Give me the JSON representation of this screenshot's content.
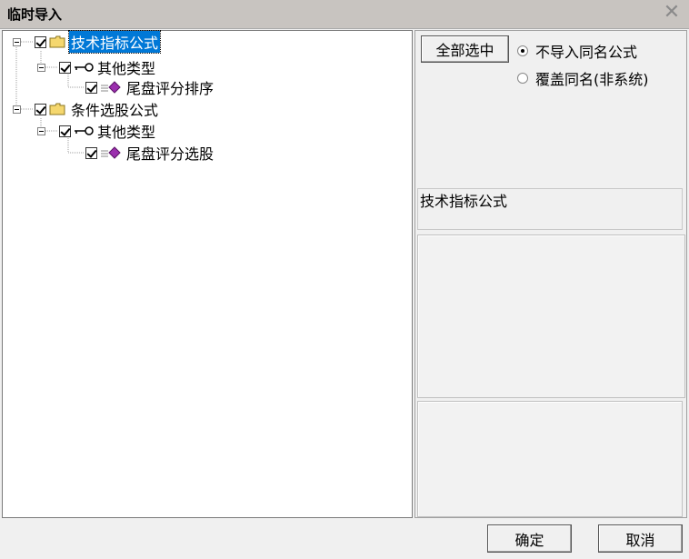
{
  "window": {
    "title": "临时导入"
  },
  "tree": [
    {
      "label": "技术指标公式",
      "icon": "folder-icon",
      "selected": true
    },
    {
      "label": "其他类型",
      "icon": "key-icon"
    },
    {
      "label": "尾盘评分排序",
      "icon": "formula-gem-icon"
    },
    {
      "label": "条件选股公式",
      "icon": "folder-icon"
    },
    {
      "label": "其他类型",
      "icon": "key-icon"
    },
    {
      "label": "尾盘评分选股",
      "icon": "formula-gem-icon"
    }
  ],
  "options": {
    "select_all_label": "全部选中",
    "skip_same_name_label": "不导入同名公式",
    "overwrite_label": "覆盖同名(非系统)",
    "selected_option": "skip_same_name"
  },
  "detail": {
    "name": "技术指标公式"
  },
  "footer": {
    "ok_label": "确定",
    "cancel_label": "取消"
  },
  "colors": {
    "selection": "#0078d7",
    "titlebar": "#c8c4c0",
    "gem": "#9b2fae",
    "folder": "#f5d76e"
  }
}
